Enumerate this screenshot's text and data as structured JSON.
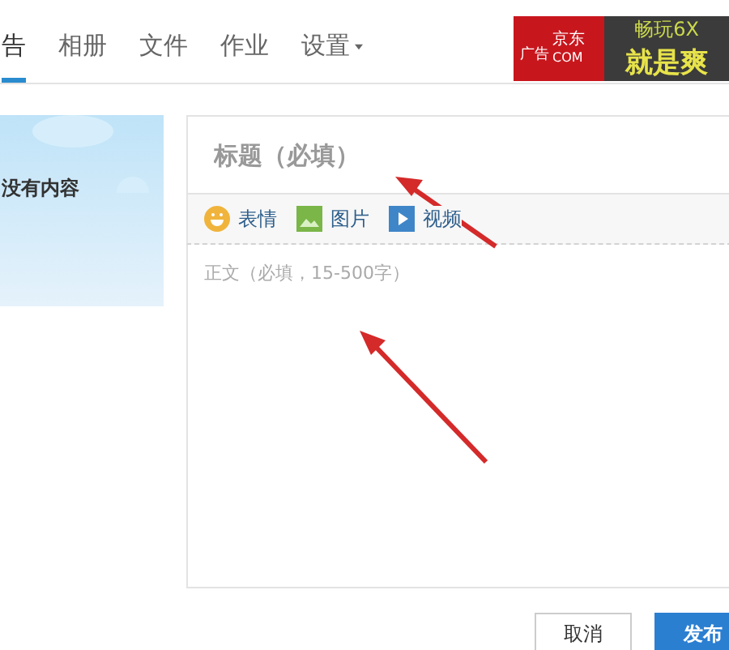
{
  "tabs": [
    {
      "label": "告",
      "selected": true,
      "dropdown": false
    },
    {
      "label": "相册",
      "selected": false,
      "dropdown": false
    },
    {
      "label": "文件",
      "selected": false,
      "dropdown": false
    },
    {
      "label": "作业",
      "selected": false,
      "dropdown": false
    },
    {
      "label": "设置",
      "selected": false,
      "dropdown": true
    }
  ],
  "ad": {
    "tag": "广告",
    "brand": "京东",
    "domain": "COM",
    "line_1": "畅玩6X",
    "line_2": "就是爽"
  },
  "sidebar": {
    "empty_text": "没有内容"
  },
  "editor": {
    "title_placeholder": "标题（必填）",
    "toolbar": [
      {
        "kind": "emoji",
        "label": "表情"
      },
      {
        "kind": "image",
        "label": "图片"
      },
      {
        "kind": "video",
        "label": "视频"
      }
    ],
    "body_placeholder": "正文（必填，15-500字）"
  },
  "buttons": [
    {
      "kind": "secondary",
      "label": "取消"
    },
    {
      "kind": "primary",
      "label": "发布"
    }
  ]
}
